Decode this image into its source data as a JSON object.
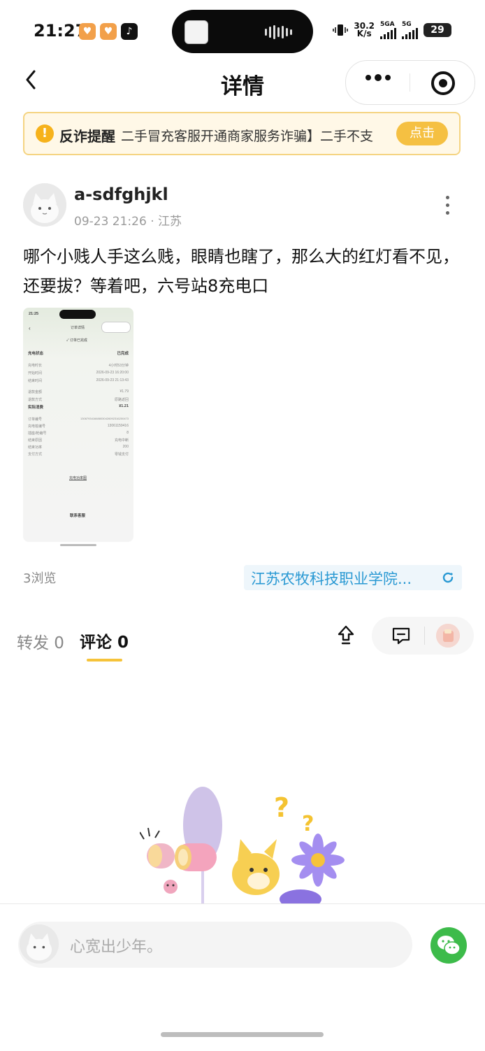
{
  "status_bar": {
    "time": "21:27",
    "net_speed_top": "30.2",
    "net_speed_bottom": "K/s",
    "sim1": "5GA",
    "sim2": "5G",
    "battery": "29"
  },
  "nav": {
    "title": "详情"
  },
  "notice": {
    "label": "反诈提醒",
    "text": "二手冒充客服开通商家服务诈骗】二手不支",
    "button": "点击"
  },
  "post": {
    "username": "a-sdfghjkl",
    "time": "09-23 21:26",
    "separator": "·",
    "location": "江苏",
    "content": "哪个小贱人手这么贱，眼睛也瞎了，那么大的红灯看不见，还要拔？等着吧，六号站8充电口",
    "views": "3浏览",
    "school_tag": "江苏农牧科技职业学院..."
  },
  "thumbnail": {
    "status_time": "21:25",
    "page_title": "订单详情",
    "order_status": "订单已完成",
    "charge_status_label": "充电状态",
    "charge_status_value": "已完成",
    "rows": [
      {
        "label": "充电时长",
        "value": "4小时53分钟"
      },
      {
        "label": "开始时间",
        "value": "2026-09-23 16:20:00"
      },
      {
        "label": "结束时间",
        "value": "2026-09-23 21:13:43"
      }
    ],
    "pay_rows": [
      {
        "label": "退款金额",
        "value": "¥1.79"
      },
      {
        "label": "退款方式",
        "value": "原路返回"
      }
    ],
    "actual_label": "实际消费",
    "actual_value": "¥1.21",
    "detail_rows": [
      {
        "label": "订单编号",
        "value": "1306793416688030426092316200473"
      },
      {
        "label": "充电桩编号",
        "value": "13061159416"
      },
      {
        "label": "插座/枪编号",
        "value": "8"
      },
      {
        "label": "结束原因",
        "value": "充电中断"
      },
      {
        "label": "结束功率",
        "value": "200"
      },
      {
        "label": "支付方式",
        "value": "零钱支付"
      }
    ],
    "link_text": "充电功率图",
    "service_text": "联系客服"
  },
  "tabs": {
    "forward": "转发 0",
    "comment": "评论 0"
  },
  "comment_input": {
    "placeholder": "心宽出少年。"
  },
  "colors": {
    "accent": "#f6c33a",
    "notice_bg": "#fff8e7",
    "link_blue": "#2a99d3",
    "wechat_green": "#3dbb4a"
  }
}
